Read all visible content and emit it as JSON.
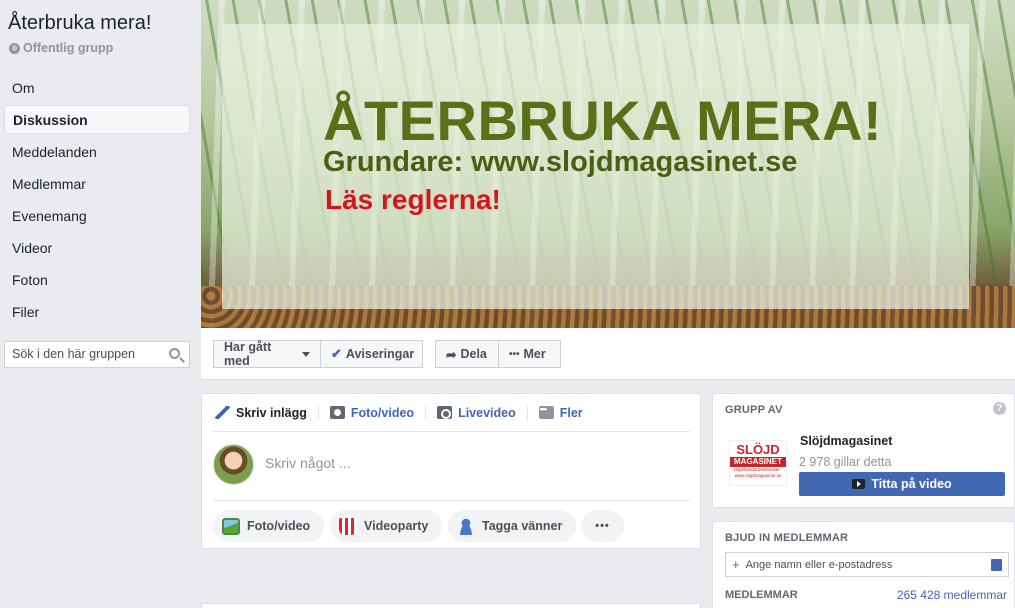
{
  "group": {
    "title": "Återbruka mera!",
    "type": "Offentlig grupp"
  },
  "nav": {
    "items": [
      "Om",
      "Diskussion",
      "Meddelanden",
      "Medlemmar",
      "Evenemang",
      "Videor",
      "Foton",
      "Filer"
    ],
    "active": "Diskussion"
  },
  "search": {
    "placeholder": "Sök i den här gruppen"
  },
  "cover": {
    "headline": "ÅTERBRUKA MERA!",
    "founder": "Grundare: www.slojdmagasinet.se",
    "rules": "Läs reglerna!"
  },
  "actions": {
    "joined": "Har gått med",
    "notifications": "Aviseringar",
    "share": "Dela",
    "more": "Mer"
  },
  "composer": {
    "tabs": [
      "Skriv inlägg",
      "Foto/video",
      "Livevideo",
      "Fler"
    ],
    "placeholder": "Skriv något ...",
    "pills": [
      "Foto/video",
      "Videoparty",
      "Tagga vänner"
    ]
  },
  "group_by": {
    "header": "GRUPP AV",
    "logo_top": "SLÖJD",
    "logo_mid": "MAGASINET",
    "logo_bot": "slöjd/handarbetsböcker · www.slojdmagasinet.se",
    "page_name": "Slöjdmagasinet",
    "likes": "2 978 gillar detta",
    "watch_button": "Titta på video"
  },
  "invite": {
    "header": "BJUD IN MEDLEMMAR",
    "placeholder": "Ange namn eller e-postadress",
    "members_label": "MEDLEMMAR",
    "members_count": "265 428 medlemmar"
  },
  "colors": {
    "brand": "#4267b2",
    "background": "#e9ebee",
    "cover_headline": "#5a6f18",
    "cover_rules": "#d4161c"
  }
}
